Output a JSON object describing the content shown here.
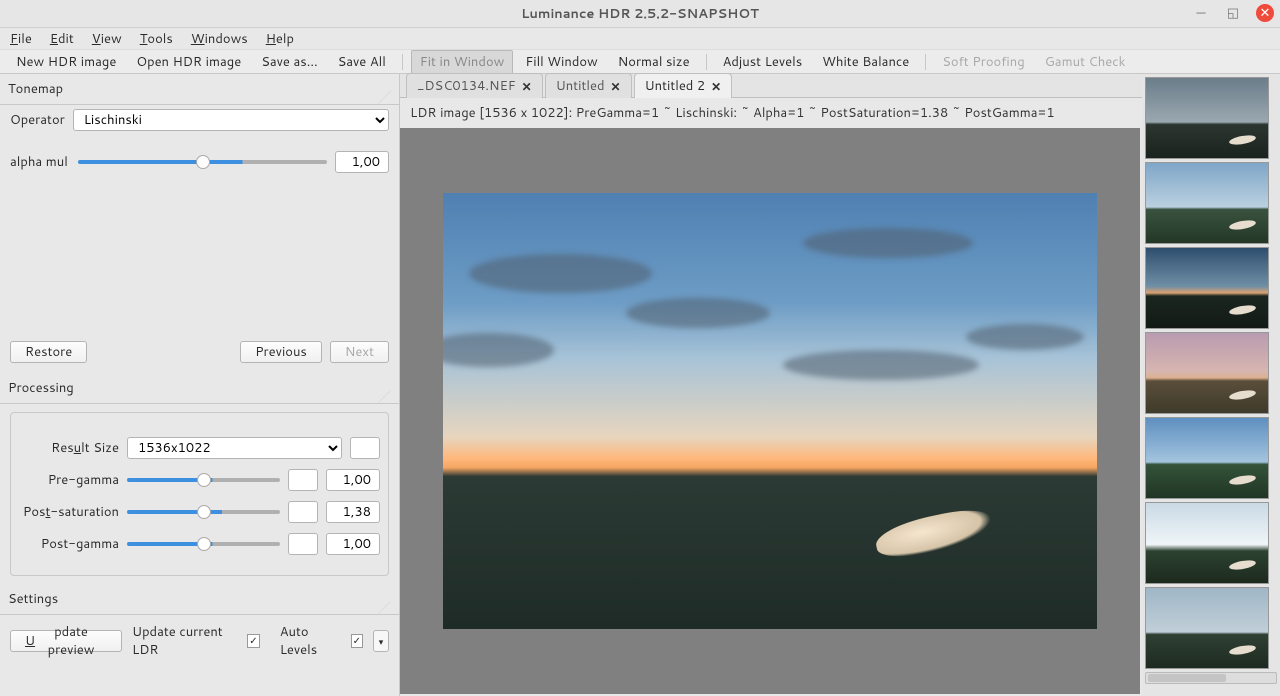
{
  "title": "Luminance HDR 2.5.2-SNAPSHOT",
  "menu": {
    "file": "File",
    "edit": "Edit",
    "view": "View",
    "tools": "Tools",
    "windows": "Windows",
    "help": "Help"
  },
  "toolbar": {
    "new": "New HDR image",
    "open": "Open HDR image",
    "saveas": "Save as...",
    "saveall": "Save All",
    "fit": "Fit in Window",
    "fill": "Fill Window",
    "normal": "Normal size",
    "levels": "Adjust Levels",
    "wb": "White Balance",
    "soft": "Soft Proofing",
    "gamut": "Gamut Check"
  },
  "tonemap": {
    "header": "Tonemap",
    "operator_label": "Operator",
    "operator_value": "Lischinski",
    "alpha_label": "alpha mul",
    "alpha_value": "1,00",
    "restore": "Restore",
    "previous": "Previous",
    "next": "Next"
  },
  "processing": {
    "header": "Processing",
    "result_label": "Result Size",
    "result_value": "1536x1022",
    "pregamma_label": "Pre-gamma",
    "pregamma_value": "1,00",
    "postsat_label": "Post-saturation",
    "postsat_value": "1,38",
    "postgamma_label": "Post-gamma",
    "postgamma_value": "1,00"
  },
  "settings": {
    "header": "Settings",
    "update_preview": "Update preview",
    "update_ldr": "Update current LDR",
    "auto_levels": "Auto Levels"
  },
  "tabs": {
    "t1": "_DSC0134.NEF",
    "t2": "Untitled",
    "t3": "Untitled 2"
  },
  "info": "LDR image [1536 x 1022]: PreGamma=1 ~ Lischinski: ~ Alpha=1 ~ PostSaturation=1.38 ~ PostGamma=1"
}
